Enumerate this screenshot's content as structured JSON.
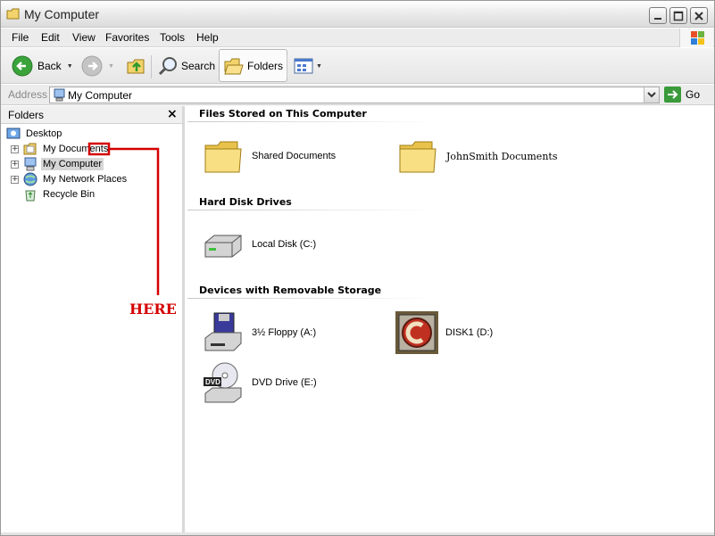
{
  "window": {
    "title": "My Computer"
  },
  "menu": [
    {
      "label": "File"
    },
    {
      "label": "Edit"
    },
    {
      "label": "View"
    },
    {
      "label": "Favorites"
    },
    {
      "label": "Tools"
    },
    {
      "label": "Help"
    }
  ],
  "toolbar": {
    "back_label": "Back",
    "search_label": "Search",
    "folders_label": "Folders"
  },
  "address": {
    "label": "Address",
    "value": "My Computer",
    "go_label": "Go"
  },
  "folders_pane": {
    "title": "Folders",
    "close_glyph": "×",
    "tree": [
      {
        "label": "Desktop",
        "icon": "desktop-icon"
      },
      {
        "label": "My Documents",
        "icon": "my-documents-icon",
        "expander": "+"
      },
      {
        "label": "My Computer",
        "icon": "my-computer-icon",
        "expander": "+",
        "selected": true
      },
      {
        "label": "My Network Places",
        "icon": "network-places-icon",
        "expander": "+"
      },
      {
        "label": "Recycle Bin",
        "icon": "recycle-bin-icon"
      }
    ]
  },
  "annotation": {
    "text": "HERE",
    "color": "#d40000"
  },
  "content": {
    "groups": [
      {
        "title": "Files Stored on This Computer",
        "items": [
          {
            "label": "Shared Documents",
            "icon": "folder-icon"
          },
          {
            "label": "JohnSmith  Documents",
            "icon": "folder-icon"
          }
        ]
      },
      {
        "title": "Hard Disk Drives",
        "items": [
          {
            "label": "Local Disk (C:)",
            "icon": "hard-disk-icon"
          }
        ]
      },
      {
        "title": "Devices with Removable Storage",
        "items": [
          {
            "label": "3½ Floppy (A:)",
            "icon": "floppy-drive-icon"
          },
          {
            "label": "DISK1 (D:)",
            "icon": "cd-disk-icon"
          },
          {
            "label": "DVD Drive (E:)",
            "icon": "dvd-drive-icon"
          }
        ]
      }
    ]
  },
  "colors": {
    "accent_red": "#d40000",
    "go_green": "#3b9a3b",
    "selection": "#d6d6d6"
  }
}
